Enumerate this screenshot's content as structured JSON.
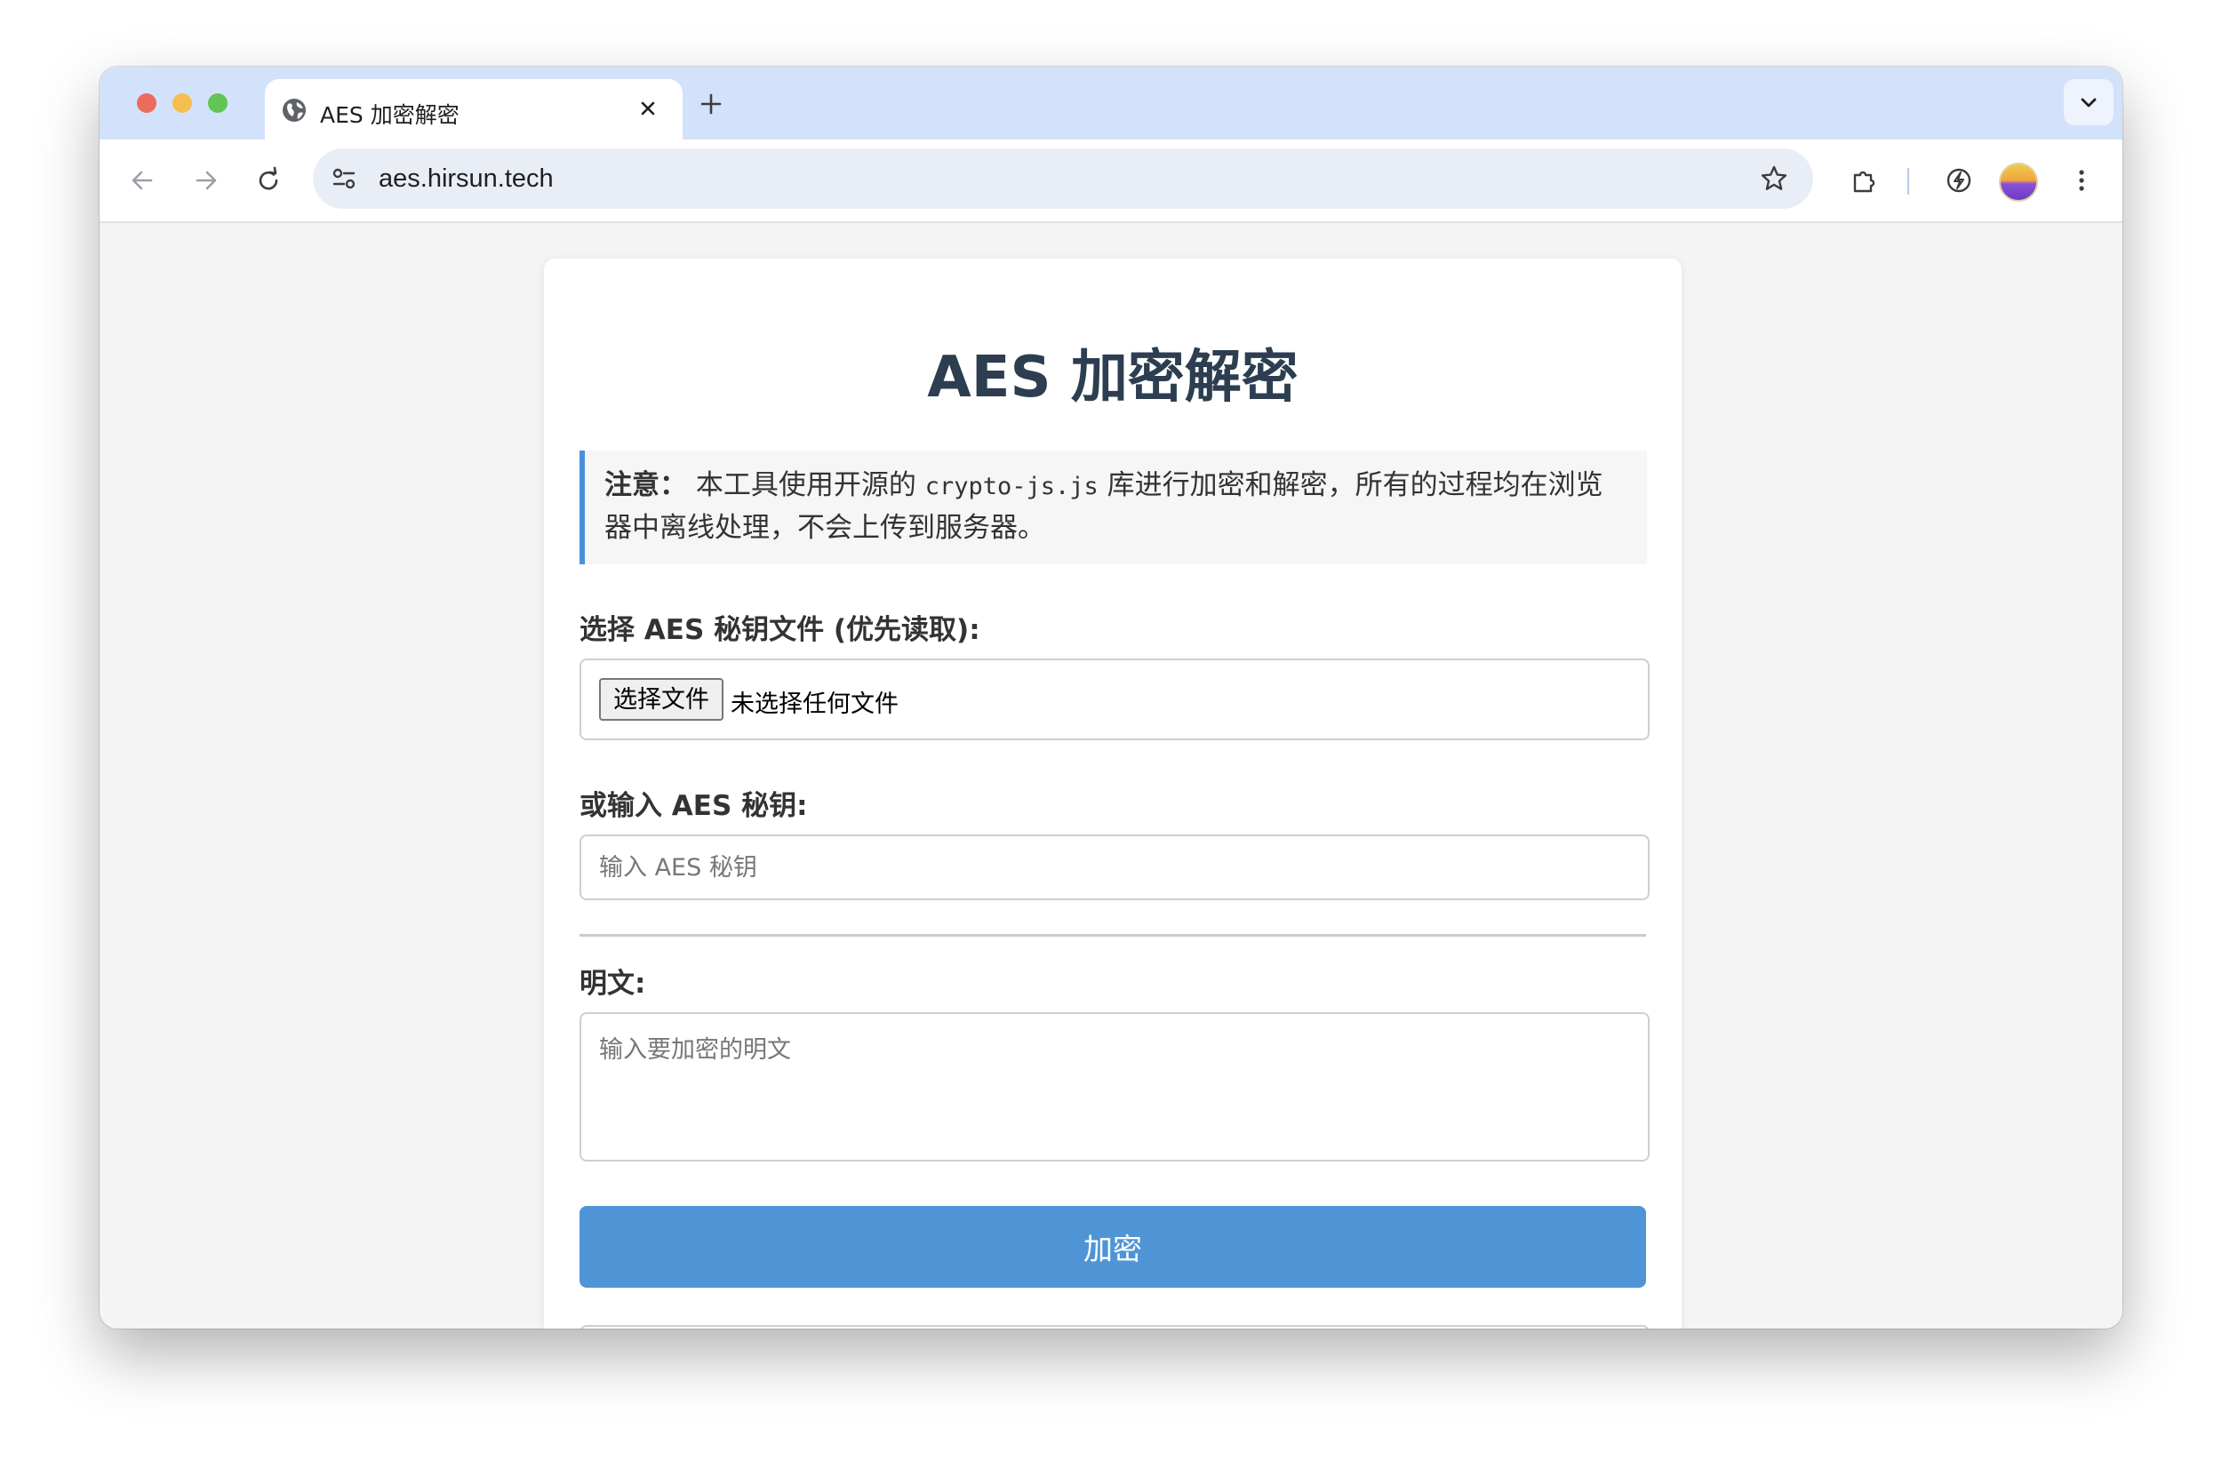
{
  "browser": {
    "tab": {
      "title": "AES 加密解密"
    },
    "address_bar": {
      "url": "aes.hirsun.tech"
    }
  },
  "page": {
    "title": "AES 加密解密",
    "notice": {
      "label": "注意：",
      "text_before": "本工具使用开源的",
      "code": "crypto-js.js",
      "text_after": "库进行加密和解密，所有的过程均在浏览器中离线处理，不会上传到服务器。"
    },
    "key_file": {
      "label": "选择 AES 秘钥文件 (优先读取):",
      "button": "选择文件",
      "status": "未选择任何文件"
    },
    "key_input": {
      "label": "或输入 AES 秘钥:",
      "placeholder": "输入 AES 秘钥",
      "value": ""
    },
    "plaintext": {
      "label": "明文:",
      "placeholder": "输入要加密的明文",
      "value": ""
    },
    "encrypt_button": "加密"
  },
  "colors": {
    "accent": "#4f95d6",
    "notice_border": "#4a90d9",
    "title": "#2c3e50",
    "tabbar": "#d3e2fb"
  },
  "icons": [
    "globe-icon",
    "close-icon",
    "plus-icon",
    "chevron-down-icon",
    "back-arrow-icon",
    "forward-arrow-icon",
    "reload-icon",
    "site-settings-icon",
    "star-icon",
    "extensions-icon",
    "performance-icon",
    "more-vert-icon"
  ]
}
